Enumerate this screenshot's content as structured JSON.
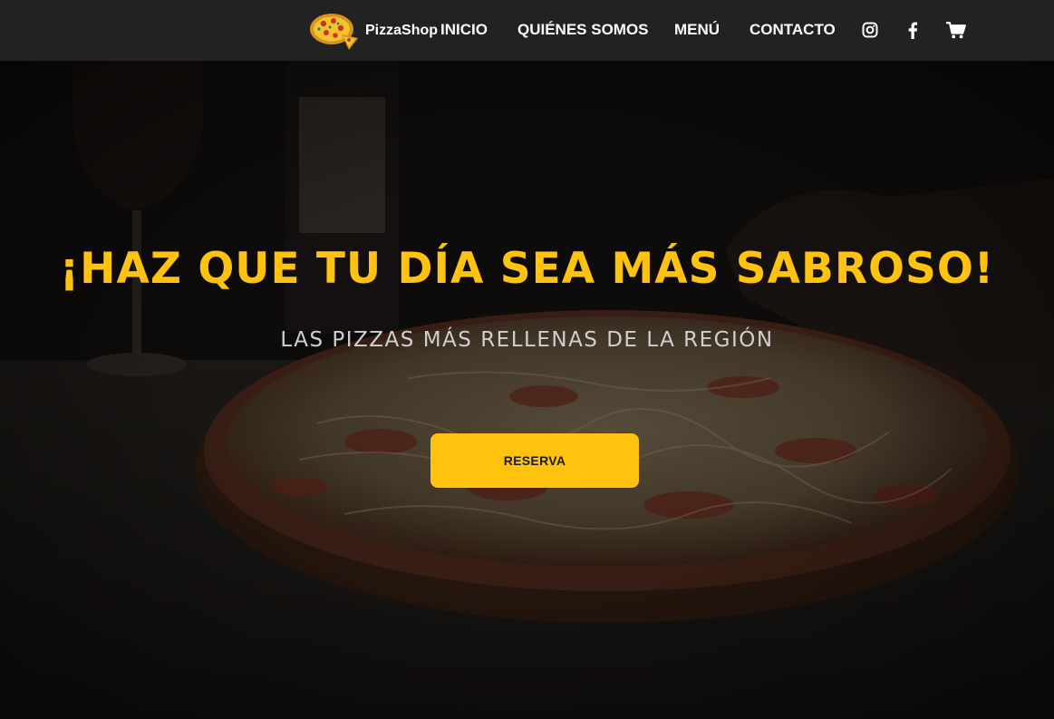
{
  "nav": {
    "brand": "PizzaShop",
    "links": [
      "INICIO",
      "QUIÉNES SOMOS",
      "MENÚ",
      "CONTACTO"
    ],
    "icons": [
      "instagram-icon",
      "facebook-icon",
      "cart-icon"
    ]
  },
  "hero": {
    "title": "¡HAZ QUE TU DÍA SEA MÁS SABROSO!",
    "subtitle": "LAS PIZZAS MÁS RELLENAS DE LA REGIÓN",
    "cta_label": "RESERVA"
  },
  "colors": {
    "accent": "#ffc20e",
    "navbar": "#222222",
    "text_on_dark": "#ffffff",
    "subtitle": "#cfcfcf"
  }
}
